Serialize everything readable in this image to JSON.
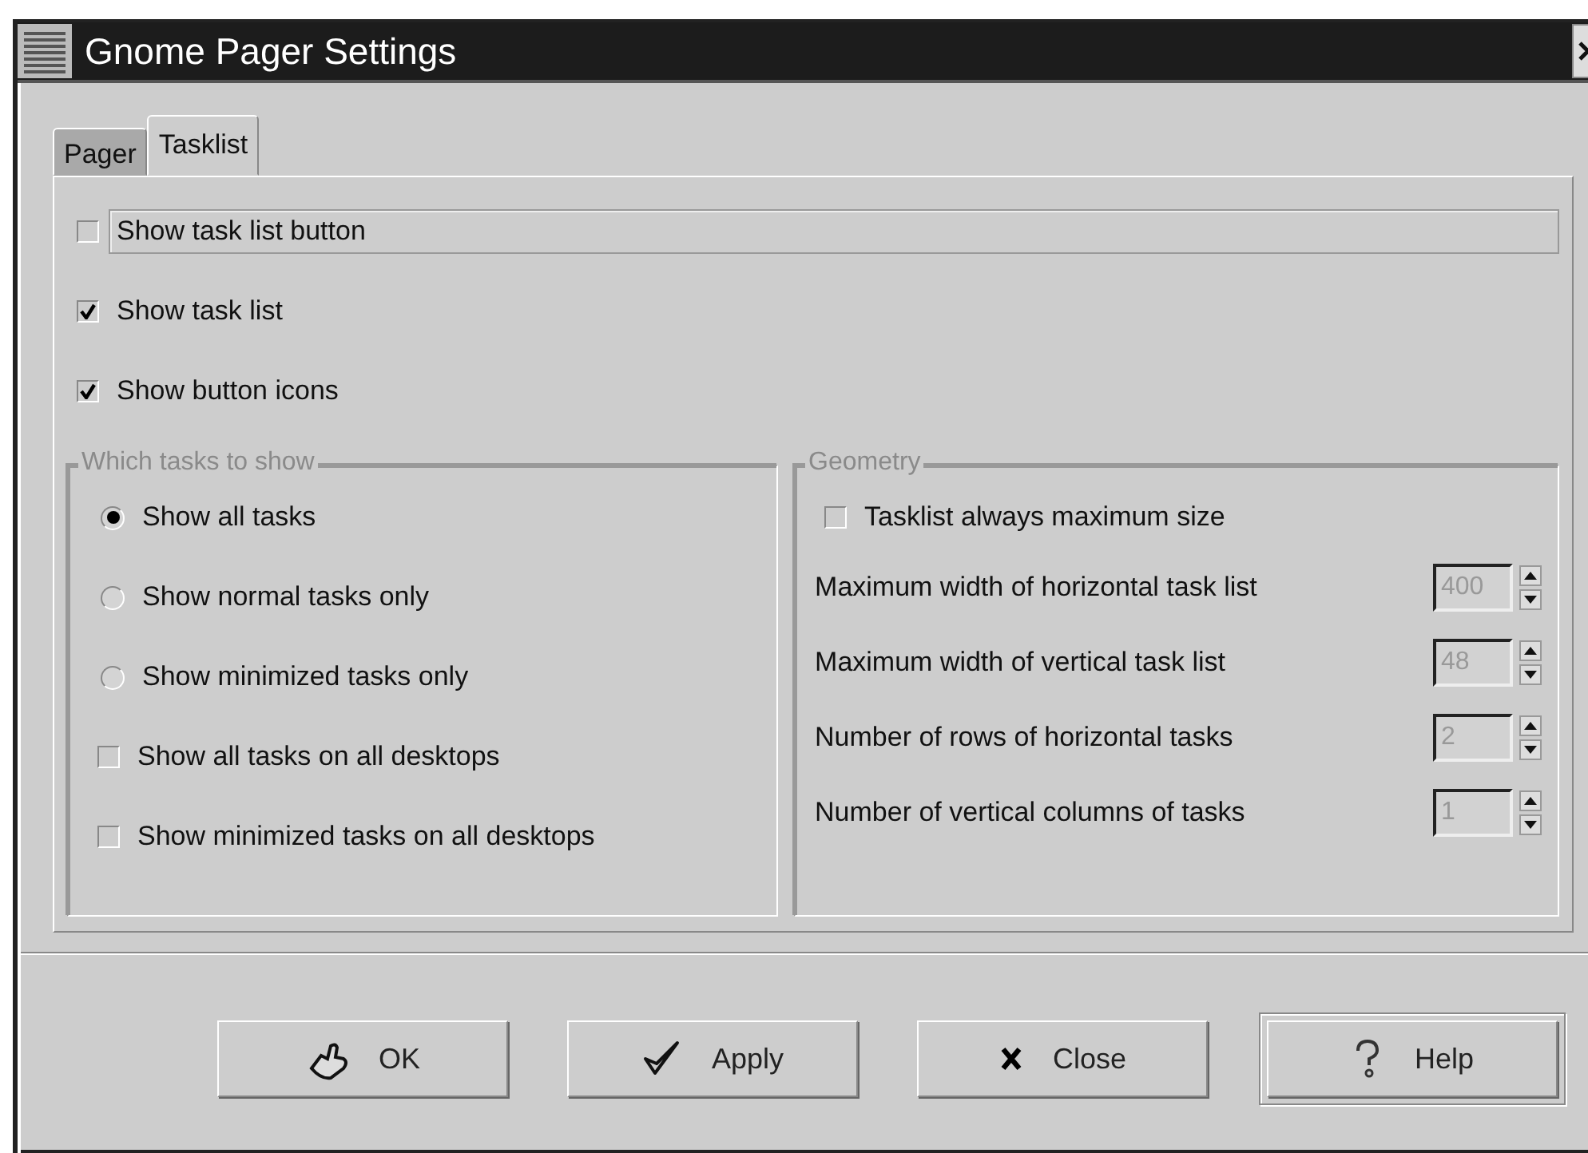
{
  "window": {
    "title": "Gnome Pager Settings"
  },
  "tabs": [
    {
      "label": "Pager",
      "selected": false
    },
    {
      "label": "Tasklist",
      "selected": true
    }
  ],
  "options": [
    {
      "label": "Show task list button",
      "checked": false,
      "focused": true
    },
    {
      "label": "Show task list",
      "checked": true,
      "focused": false
    },
    {
      "label": "Show button icons",
      "checked": true,
      "focused": false
    }
  ],
  "which_tasks": {
    "title": "Which tasks to show",
    "items": [
      {
        "kind": "radio",
        "label": "Show all tasks",
        "selected": true
      },
      {
        "kind": "radio",
        "label": "Show normal tasks only",
        "selected": false
      },
      {
        "kind": "radio",
        "label": "Show minimized tasks only",
        "selected": false
      },
      {
        "kind": "checkbox",
        "label": "Show all tasks on all desktops",
        "checked": false
      },
      {
        "kind": "checkbox",
        "label": "Show minimized tasks on all desktops",
        "checked": false
      }
    ]
  },
  "geometry": {
    "title": "Geometry",
    "always_max": {
      "label": "Tasklist always maximum size",
      "checked": false
    },
    "spins": [
      {
        "label": "Maximum width of horizontal task list",
        "value": "400",
        "disabled": true
      },
      {
        "label": "Maximum width of vertical task list",
        "value": "48",
        "disabled": true
      },
      {
        "label": "Number of rows of horizontal tasks",
        "value": "2",
        "disabled": true
      },
      {
        "label": "Number of vertical columns of tasks",
        "value": "1",
        "disabled": true
      }
    ]
  },
  "buttons": [
    {
      "label": "OK",
      "kind": "ok",
      "default": false
    },
    {
      "label": "Apply",
      "kind": "apply",
      "default": false
    },
    {
      "label": "Close",
      "kind": "close",
      "default": false
    },
    {
      "label": "Help",
      "kind": "help",
      "default": true
    }
  ]
}
